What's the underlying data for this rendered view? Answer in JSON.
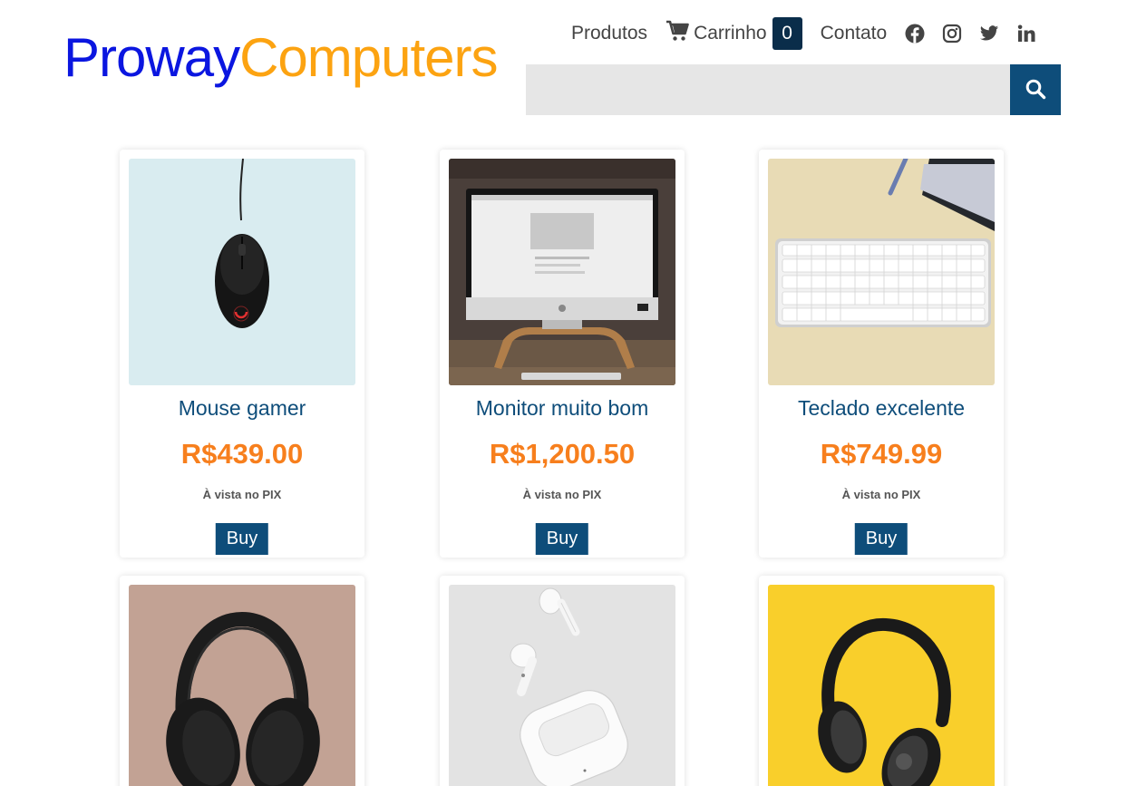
{
  "brand": {
    "part1": "Proway",
    "part2": "Computers"
  },
  "nav": {
    "products": "Produtos",
    "cart_label": "Carrinho",
    "cart_count": "0",
    "contact": "Contato"
  },
  "search": {
    "placeholder": ""
  },
  "products": [
    {
      "name": "Mouse gamer",
      "price": "R$439.00",
      "payment_note": "À vista no PIX",
      "buy_label": "Buy"
    },
    {
      "name": "Monitor muito bom",
      "price": "R$1,200.50",
      "payment_note": "À vista no PIX",
      "buy_label": "Buy"
    },
    {
      "name": "Teclado excelente",
      "price": "R$749.99",
      "payment_note": "À vista no PIX",
      "buy_label": "Buy"
    },
    {
      "name": "",
      "price": "",
      "payment_note": "",
      "buy_label": ""
    },
    {
      "name": "",
      "price": "",
      "payment_note": "",
      "buy_label": ""
    },
    {
      "name": "",
      "price": "",
      "payment_note": "",
      "buy_label": ""
    }
  ],
  "icons": [
    "cart-icon",
    "facebook-icon",
    "instagram-icon",
    "twitter-icon",
    "linkedin-icon",
    "search-icon"
  ],
  "colors": {
    "brand_blue": "#0b16e0",
    "brand_orange": "#fca311",
    "primary": "#0e4d7a",
    "price": "#f77f1d",
    "badge": "#0a2d4a"
  }
}
